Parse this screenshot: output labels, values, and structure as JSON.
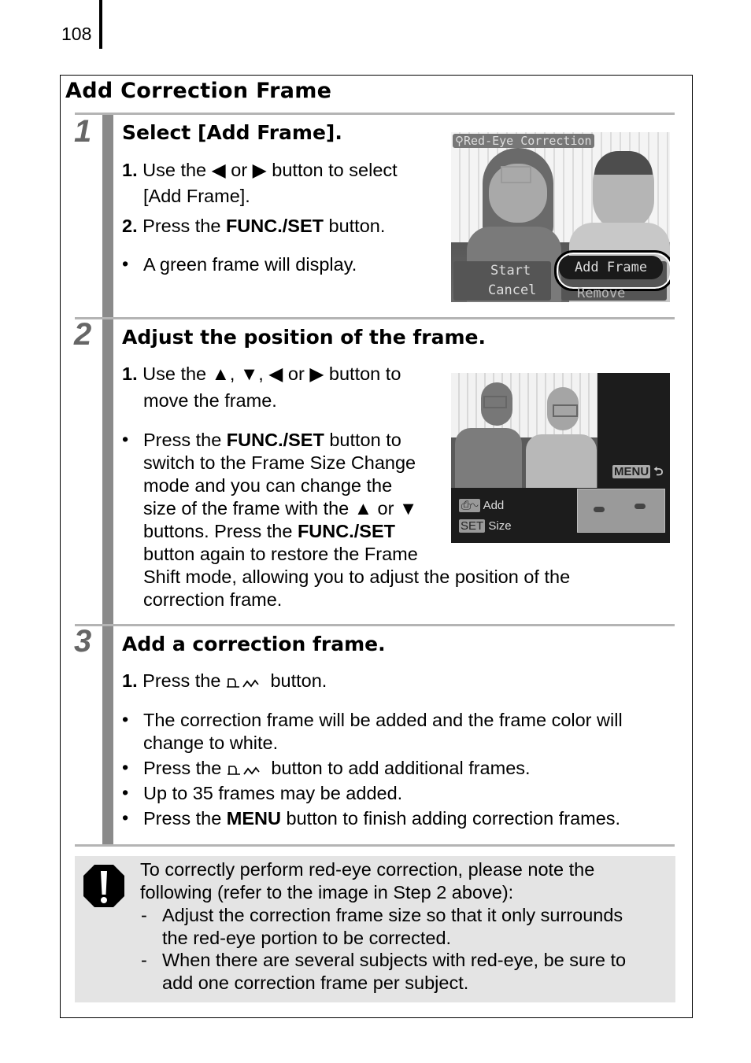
{
  "page_number": "108",
  "section_title": "Add Correction Frame",
  "steps": [
    {
      "number": "1",
      "title": "Select [Add Frame].",
      "items": [
        {
          "prefix": "1.",
          "text_a": "Use the ◀ or ▶ button to select",
          "text_b": "[Add Frame]."
        },
        {
          "prefix": "2.",
          "text_a": "Press the ",
          "bold": "FUNC./SET",
          "text_b": " button."
        }
      ],
      "bullets": [
        "A green frame will display."
      ],
      "screen": {
        "title": "Red-Eye Correction",
        "menu": [
          "Start",
          "Add Frame",
          "Cancel",
          "Remove Frame"
        ],
        "selected": "Add Frame"
      }
    },
    {
      "number": "2",
      "title": "Adjust the position of the frame.",
      "items": [
        {
          "prefix": "1.",
          "text_a": "Use the ▲, ▼, ◀ or ▶ button to",
          "text_b": "move the frame."
        }
      ],
      "bullet_lines": [
        [
          "Press the ",
          "FUNC./SET",
          " button to"
        ],
        [
          "switch to the Frame Size Change"
        ],
        [
          "mode and you can change the"
        ],
        [
          "size of the frame with the ▲ or ▼"
        ],
        [
          "buttons. Press the ",
          "FUNC./SET",
          ""
        ],
        [
          "button again to restore the Frame"
        ],
        [
          "Shift mode, allowing you to adjust the position of the"
        ],
        [
          "correction frame."
        ]
      ],
      "screen": {
        "menu_label": "MENU",
        "add_label": "Add",
        "set_label": "SET",
        "size_label": "Size"
      }
    },
    {
      "number": "3",
      "title": "Add a correction frame.",
      "items": [
        {
          "prefix": "1.",
          "text_a": "Press the ",
          "text_b": " button."
        }
      ],
      "bullets": [
        {
          "a": "The correction frame will be added and the frame color will",
          "b": "change to white."
        },
        {
          "a": "Press the ",
          "icon": true,
          "b": " button to add additional frames."
        },
        {
          "a": "Up to 35 frames may be added."
        },
        {
          "a": "Press the ",
          "bold": "MENU",
          "b": " button to finish adding correction frames."
        }
      ]
    }
  ],
  "note": {
    "lines": [
      "To correctly perform red-eye correction, please note the",
      "following (refer to the image in Step 2 above):"
    ],
    "dash_items": [
      [
        "Adjust the correction frame size so that it only surrounds",
        "the red-eye portion to be corrected."
      ],
      [
        "When there are several subjects with red-eye, be sure to",
        "add one correction frame per subject."
      ]
    ]
  }
}
